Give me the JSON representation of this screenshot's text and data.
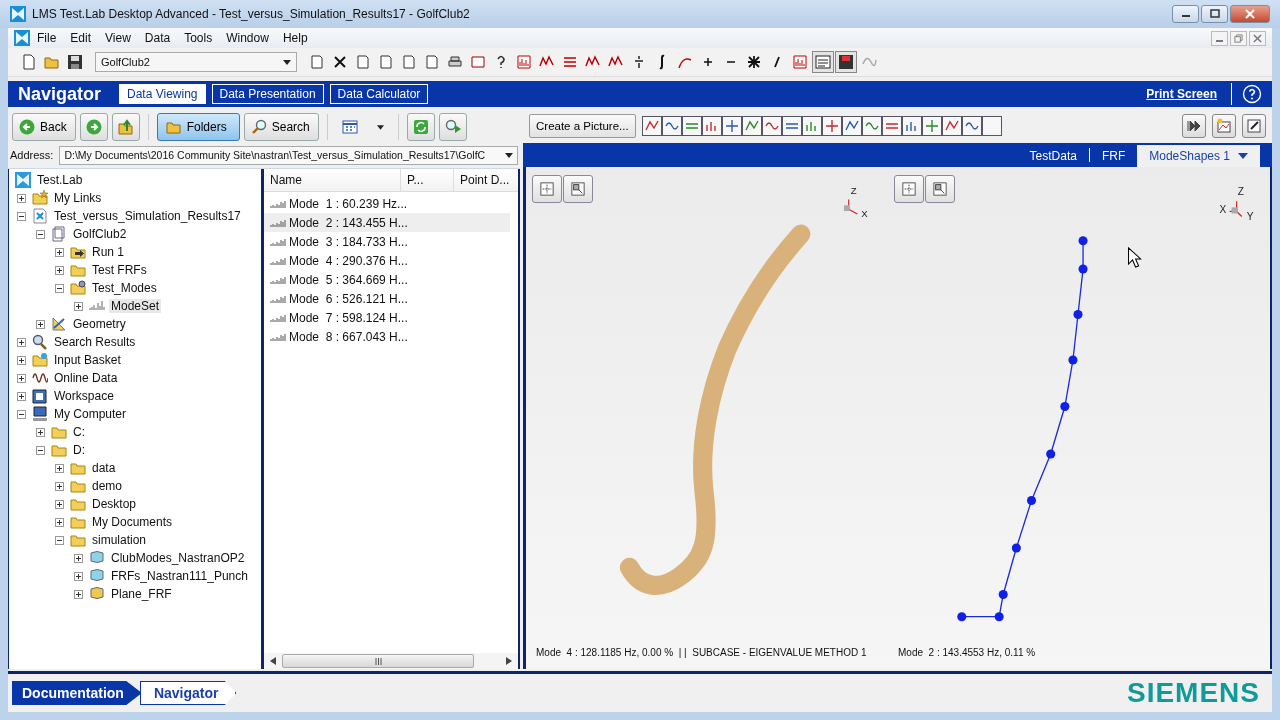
{
  "window": {
    "title": "LMS Test.Lab Desktop Advanced - Test_versus_Simulation_Results17 - GolfClub2"
  },
  "menu": [
    "File",
    "Edit",
    "View",
    "Data",
    "Tools",
    "Window",
    "Help"
  ],
  "toolbar": {
    "project": "GolfClub2"
  },
  "navigator": {
    "title": "Navigator",
    "tabs": [
      {
        "label": "Data Viewing",
        "selected": true
      },
      {
        "label": "Data Presentation",
        "selected": false
      },
      {
        "label": "Data Calculator",
        "selected": false
      }
    ],
    "print_screen": "Print Screen"
  },
  "browser": {
    "buttons": [
      {
        "label": "Back",
        "kind": "back",
        "selected": false
      },
      {
        "label": "Folders",
        "kind": "folders",
        "selected": true
      },
      {
        "label": "Search",
        "kind": "search",
        "selected": false
      }
    ],
    "address_label": "Address:",
    "address": "D:\\My Documents\\2016 Community Site\\nastran\\Test_versus_Simulation_Results17\\GolfC"
  },
  "tree": [
    {
      "label": "Test.Lab",
      "kind": "testlab",
      "selected": false,
      "children": [
        {
          "label": "My Links",
          "kind": "links",
          "expanded": false,
          "selected": false
        },
        {
          "label": "Test_versus_Simulation_Results17",
          "kind": "project",
          "expanded": true,
          "selected": false,
          "children": [
            {
              "label": "GolfClub2",
              "kind": "document",
              "expanded": true,
              "selected": false,
              "children": [
                {
                  "label": "Run 1",
                  "kind": "run",
                  "expanded": false,
                  "selected": false
                },
                {
                  "label": "Test FRFs",
                  "kind": "folder",
                  "expanded": false,
                  "selected": false
                },
                {
                  "label": "Test_Modes",
                  "kind": "modes",
                  "expanded": true,
                  "selected": false,
                  "children": [
                    {
                      "label": "ModeSet",
                      "kind": "modeset",
                      "expanded": false,
                      "selected": true
                    }
                  ]
                }
              ]
            },
            {
              "label": "Geometry",
              "kind": "geometry",
              "expanded": false,
              "selected": false
            }
          ]
        },
        {
          "label": "Search Results",
          "kind": "search",
          "expanded": false,
          "selected": false
        },
        {
          "label": "Input Basket",
          "kind": "basket",
          "expanded": false,
          "selected": false
        },
        {
          "label": "Online Data",
          "kind": "online",
          "expanded": false,
          "selected": false
        },
        {
          "label": "Workspace",
          "kind": "workspace",
          "expanded": false,
          "selected": false
        },
        {
          "label": "My Computer",
          "kind": "computer",
          "expanded": true,
          "selected": false,
          "children": [
            {
              "label": "C:",
              "kind": "folder",
              "expanded": false,
              "selected": false
            },
            {
              "label": "D:",
              "kind": "folder",
              "expanded": true,
              "selected": false,
              "children": [
                {
                  "label": "data",
                  "kind": "folder",
                  "expanded": false,
                  "selected": false
                },
                {
                  "label": "demo",
                  "kind": "folder",
                  "expanded": false,
                  "selected": false
                },
                {
                  "label": "Desktop",
                  "kind": "folder",
                  "expanded": false,
                  "selected": false
                },
                {
                  "label": "My Documents",
                  "kind": "folder",
                  "expanded": false,
                  "selected": false
                },
                {
                  "label": "simulation",
                  "kind": "folder",
                  "expanded": true,
                  "selected": false,
                  "children": [
                    {
                      "label": "ClubModes_NastranOP2",
                      "kind": "nas",
                      "expanded": false,
                      "selected": false
                    },
                    {
                      "label": "FRFs_Nastran111_Punch",
                      "kind": "nas",
                      "expanded": false,
                      "selected": false
                    },
                    {
                      "label": "Plane_FRF",
                      "kind": "afu",
                      "expanded": false,
                      "selected": false
                    }
                  ]
                }
              ]
            }
          ]
        }
      ]
    }
  ],
  "list": {
    "columns": [
      "Name",
      "P...",
      "Point D..."
    ],
    "rows": [
      {
        "name": "Mode  1 : 60.239 Hz...",
        "selected": false
      },
      {
        "name": "Mode  2 : 143.455 H...",
        "selected": true
      },
      {
        "name": "Mode  3 : 184.733 H...",
        "selected": false
      },
      {
        "name": "Mode  4 : 290.376 H...",
        "selected": false
      },
      {
        "name": "Mode  5 : 364.669 H...",
        "selected": false
      },
      {
        "name": "Mode  6 : 526.121 H...",
        "selected": false
      },
      {
        "name": "Mode  7 : 598.124 H...",
        "selected": false
      },
      {
        "name": "Mode  8 : 667.043 H...",
        "selected": false
      }
    ]
  },
  "display": {
    "create_picture": "Create a Picture...",
    "tabs": [
      {
        "label": "TestData",
        "selected": false
      },
      {
        "label": "FRF",
        "selected": false
      },
      {
        "label": "ModeShapes 1",
        "selected": true
      }
    ],
    "views": [
      {
        "kind": "surface",
        "axes": [
          "Z",
          "X"
        ],
        "status": "Mode  4 : 128.1185 Hz, 0.00 %  | |  SUBCASE - EIGENVALUE METHOD 1"
      },
      {
        "kind": "wireframe",
        "axes": [
          "Z",
          "X",
          "Y"
        ],
        "status": "Mode  2 : 143.4553 Hz, 0.11 %"
      }
    ]
  },
  "breadcrumbs": [
    {
      "label": "Documentation",
      "selected": true
    },
    {
      "label": "Navigator",
      "selected": false
    }
  ],
  "logo": "SIEMENS"
}
